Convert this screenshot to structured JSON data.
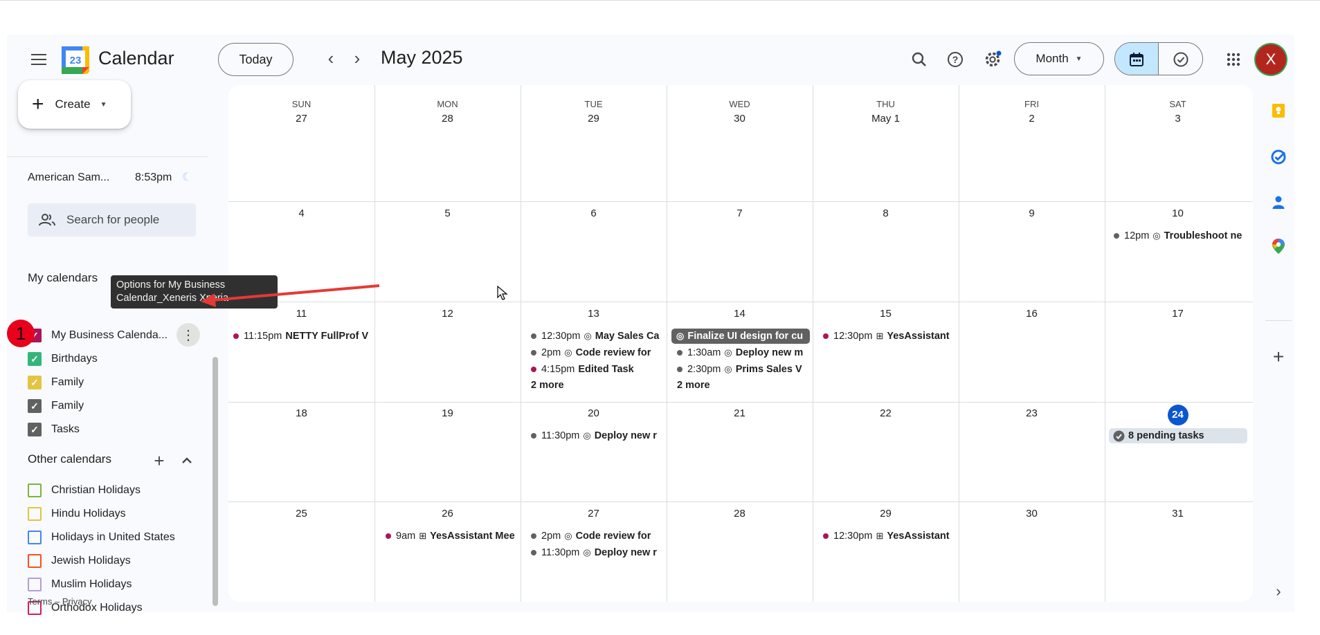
{
  "header": {
    "app_title": "Calendar",
    "logo_day": "23",
    "today_label": "Today",
    "month_title": "May 2025",
    "view_label": "Month",
    "avatar_letter": "X"
  },
  "sidebar": {
    "create_label": "Create",
    "timezone": {
      "name": "American Sam...",
      "time": "8:53pm"
    },
    "search_people_placeholder": "Search for people",
    "my_calendars_title": "My calendars",
    "my_calendars": [
      {
        "label": "My Business Calenda...",
        "color": "#ad1457",
        "checked": true
      },
      {
        "label": "Birthdays",
        "color": "#33b679",
        "checked": true
      },
      {
        "label": "Family",
        "color": "#e4c441",
        "checked": true
      },
      {
        "label": "Family",
        "color": "#616161",
        "checked": true
      },
      {
        "label": "Tasks",
        "color": "#616161",
        "checked": true
      }
    ],
    "other_calendars_title": "Other calendars",
    "other_calendars": [
      {
        "label": "Christian Holidays",
        "color": "#7cb342"
      },
      {
        "label": "Hindu Holidays",
        "color": "#e4c441"
      },
      {
        "label": "Holidays in United States",
        "color": "#4285f4"
      },
      {
        "label": "Jewish Holidays",
        "color": "#f4511e"
      },
      {
        "label": "Muslim Holidays",
        "color": "#b39ddb"
      },
      {
        "label": "Orthodox Holidays",
        "color": "#d81b60"
      }
    ],
    "tooltip_line1": "Options for My Business",
    "tooltip_line2": "Calendar_Xeneris Xperia",
    "annotation_badge": "1",
    "footer": "Terms – Privacy"
  },
  "calendar": {
    "weekdays": [
      "SUN",
      "MON",
      "TUE",
      "WED",
      "THU",
      "FRI",
      "SAT"
    ],
    "weeks": [
      [
        "27",
        "28",
        "29",
        "30",
        "May 1",
        "2",
        "3"
      ],
      [
        "4",
        "5",
        "6",
        "7",
        "8",
        "9",
        "10"
      ],
      [
        "11",
        "12",
        "13",
        "14",
        "15",
        "16",
        "17"
      ],
      [
        "18",
        "19",
        "20",
        "21",
        "22",
        "23",
        "24"
      ],
      [
        "25",
        "26",
        "27",
        "28",
        "29",
        "30",
        "31"
      ]
    ],
    "today": "24",
    "events": {
      "w1_sat": {
        "time": "12pm",
        "title": "Troubleshoot ne"
      },
      "w2_sun": {
        "time": "11:15pm",
        "title": "NETTY FullProf V"
      },
      "w2_tue_1": {
        "time": "12:30pm",
        "title": "May Sales Ca"
      },
      "w2_tue_2": {
        "time": "2pm",
        "title": "Code review for"
      },
      "w2_tue_3": {
        "time": "4:15pm",
        "title": "Edited Task"
      },
      "w2_tue_more": "2 more",
      "w2_wed_chip": {
        "title": "Finalize UI design for cu"
      },
      "w2_wed_1": {
        "time": "1:30am",
        "title": "Deploy new m"
      },
      "w2_wed_2": {
        "time": "2:30pm",
        "title": "Prims Sales V"
      },
      "w2_wed_more": "2 more",
      "w2_thu": {
        "time": "12:30pm",
        "title": "YesAssistant"
      },
      "w3_tue": {
        "time": "11:30pm",
        "title": "Deploy new r"
      },
      "w3_sat_pending": "8 pending tasks",
      "w4_mon": {
        "time": "9am",
        "title": "YesAssistant Mee"
      },
      "w4_tue_1": {
        "time": "2pm",
        "title": "Code review for"
      },
      "w4_tue_2": {
        "time": "11:30pm",
        "title": "Deploy new r"
      },
      "w4_thu": {
        "time": "12:30pm",
        "title": "YesAssistant"
      }
    }
  },
  "colors": {
    "accent": "#0b57d0",
    "business": "#ad1457",
    "task_gray": "#616161"
  }
}
